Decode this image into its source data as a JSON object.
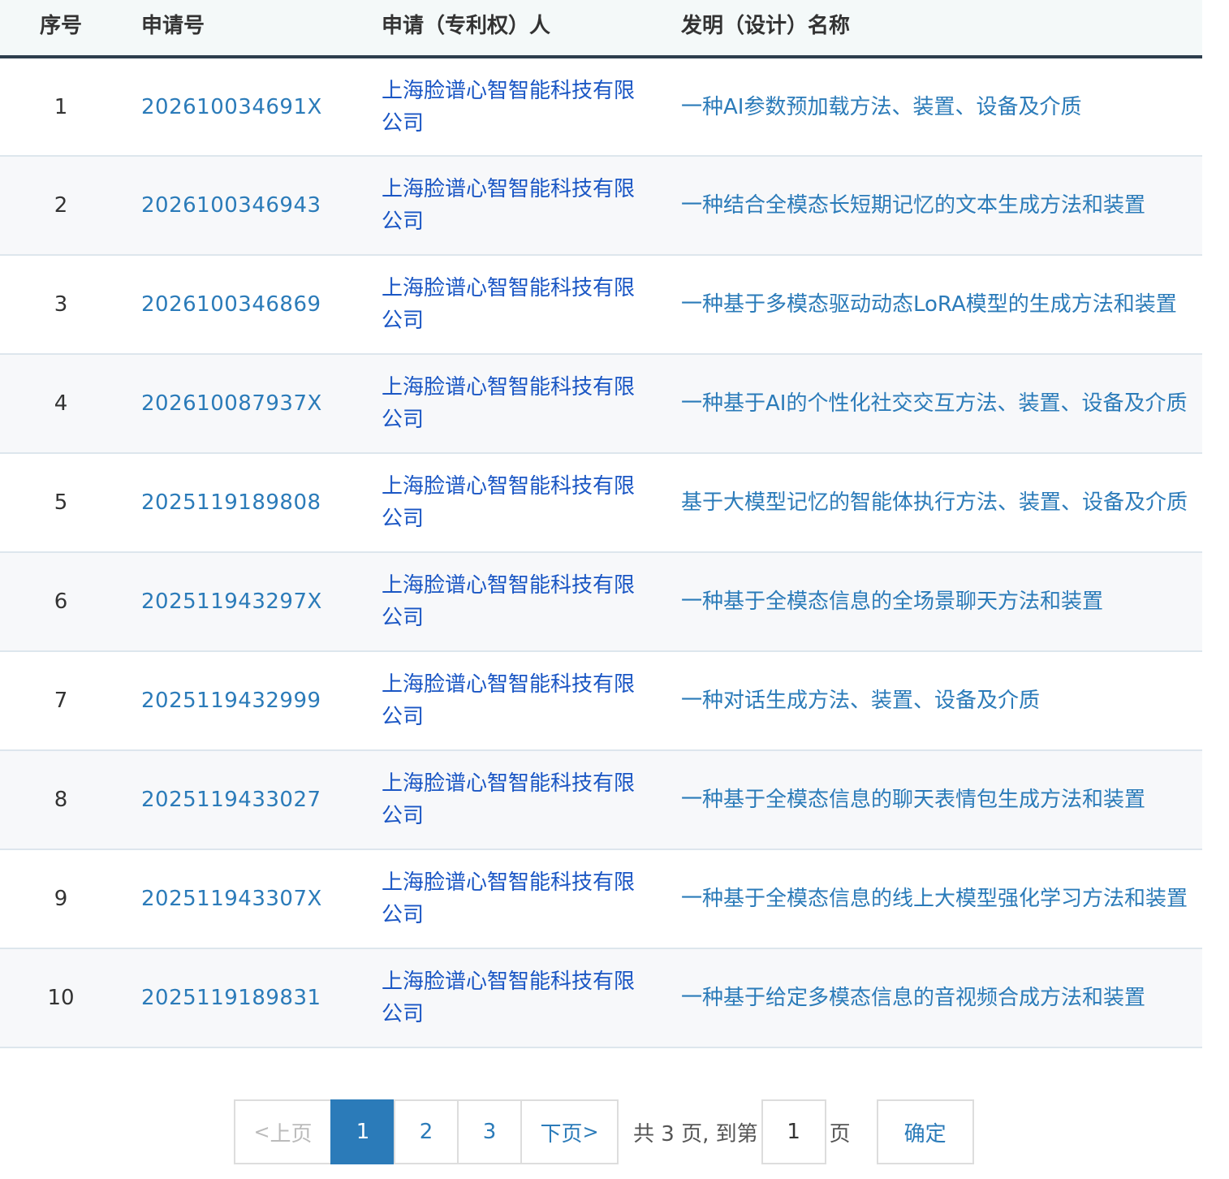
{
  "table": {
    "headers": {
      "index": "序号",
      "application_no": "申请号",
      "applicant": "申请（专利权）人",
      "title": "发明（设计）名称"
    },
    "rows": [
      {
        "index": "1",
        "application_no": "202610034691X",
        "applicant": "上海脸谱心智智能科技有限公司",
        "title": "一种AI参数预加载方法、装置、设备及介质"
      },
      {
        "index": "2",
        "application_no": "2026100346943",
        "applicant": "上海脸谱心智智能科技有限公司",
        "title": "一种结合全模态长短期记忆的文本生成方法和装置"
      },
      {
        "index": "3",
        "application_no": "2026100346869",
        "applicant": "上海脸谱心智智能科技有限公司",
        "title": "一种基于多模态驱动动态LoRA模型的生成方法和装置"
      },
      {
        "index": "4",
        "application_no": "202610087937X",
        "applicant": "上海脸谱心智智能科技有限公司",
        "title": "一种基于AI的个性化社交交互方法、装置、设备及介质"
      },
      {
        "index": "5",
        "application_no": "2025119189808",
        "applicant": "上海脸谱心智智能科技有限公司",
        "title": "基于大模型记忆的智能体执行方法、装置、设备及介质"
      },
      {
        "index": "6",
        "application_no": "202511943297X",
        "applicant": "上海脸谱心智智能科技有限公司",
        "title": "一种基于全模态信息的全场景聊天方法和装置"
      },
      {
        "index": "7",
        "application_no": "2025119432999",
        "applicant": "上海脸谱心智智能科技有限公司",
        "title": "一种对话生成方法、装置、设备及介质"
      },
      {
        "index": "8",
        "application_no": "2025119433027",
        "applicant": "上海脸谱心智智能科技有限公司",
        "title": "一种基于全模态信息的聊天表情包生成方法和装置"
      },
      {
        "index": "9",
        "application_no": "202511943307X",
        "applicant": "上海脸谱心智智能科技有限公司",
        "title": "一种基于全模态信息的线上大模型强化学习方法和装置"
      },
      {
        "index": "10",
        "application_no": "2025119189831",
        "applicant": "上海脸谱心智智能科技有限公司",
        "title": "一种基于给定多模态信息的音视频合成方法和装置"
      }
    ]
  },
  "pagination": {
    "prev_label": "上页",
    "next_label": "下页",
    "prev_chevron": "<",
    "next_chevron": ">",
    "pages": [
      "1",
      "2",
      "3"
    ],
    "current_page": "1",
    "total_text": "共 3 页, 到第",
    "page_suffix": "页",
    "goto_value": "1",
    "confirm_label": "确定"
  },
  "colors": {
    "link": "#2b7bb9",
    "applicant_link": "#1a56c4",
    "header_border": "#2d3e4e",
    "current_page_bg": "#2b7bb9"
  }
}
